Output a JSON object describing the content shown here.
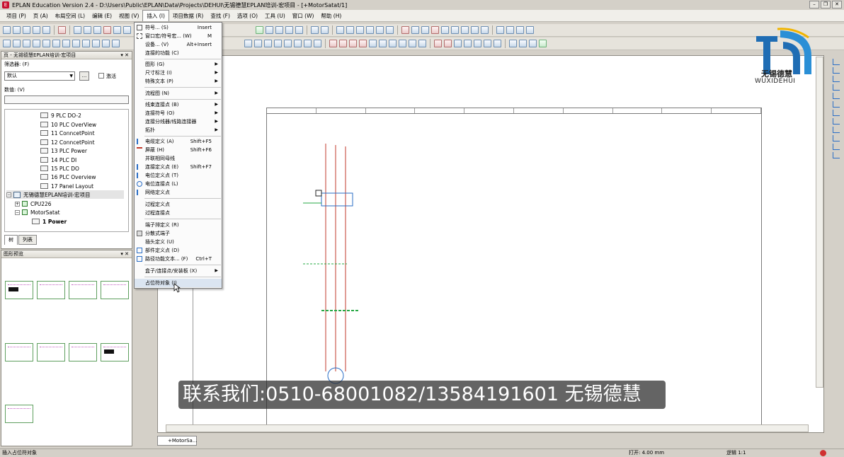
{
  "window": {
    "title": "EPLAN Education Version 2.4 - D:\\Users\\Public\\EPLAN\\Data\\Projects\\DEHUI\\无锡德慧EPLAN培训-宏项目 - [+MotorSatat/1]"
  },
  "menubar": [
    "项目 (P)",
    "页 (A)",
    "布局空间 (L)",
    "编辑 (E)",
    "视图 (V)",
    "插入 (I)",
    "项目数据 (R)",
    "查找 (F)",
    "选项 (O)",
    "工具 (U)",
    "窗口 (W)",
    "帮助 (H)"
  ],
  "page_panel": {
    "title": "页 - 无锡德慧EPLAN培训-宏项目",
    "filter_label": "筛选器: (F)",
    "filter_value": "默认",
    "more_button": "...",
    "activate_label": "激活",
    "value_label": "数值: (V)",
    "pages": [
      "9 PLC DO-2",
      "10 PLC OverView",
      "11 ConncetPoint",
      "12 ConncetPoint",
      "13 PLC Power",
      "14 PLC DI",
      "15 PLC DO",
      "16 PLC Overview",
      "17 Panel Layout"
    ],
    "project": "无锡德慧EPLAN培训-宏项目",
    "node_cpu": "CPU226",
    "node_motor": "MotorSatat",
    "node_power": "1 Power",
    "tab_tree": "树",
    "tab_list": "列表"
  },
  "preview_panel": {
    "title": "图形预览"
  },
  "insert_menu": {
    "items": [
      {
        "label": "符号... (S)",
        "shortcut": "Insert"
      },
      {
        "label": "窗口宏/符号宏... (W)",
        "shortcut": "M"
      },
      {
        "label": "设备... (V)",
        "shortcut": "Alt+Insert"
      },
      {
        "label": "连接的功能 (C)",
        "shortcut": ""
      },
      {
        "label": "图形 (G)",
        "shortcut": ""
      },
      {
        "label": "尺寸标注 (I)",
        "shortcut": ""
      },
      {
        "label": "特殊文本 (P)",
        "shortcut": ""
      },
      {
        "label": "流程图 (N)",
        "shortcut": ""
      },
      {
        "label": "线束连接点 (B)",
        "shortcut": ""
      },
      {
        "label": "连接符号 (O)",
        "shortcut": ""
      },
      {
        "label": "连接分线器/线路连接器",
        "shortcut": ""
      },
      {
        "label": "拓扑",
        "shortcut": ""
      },
      {
        "label": "电缆定义 (A)",
        "shortcut": "Shift+F5"
      },
      {
        "label": "屏蔽 (H)",
        "shortcut": "Shift+F6"
      },
      {
        "label": "并联相同母线",
        "shortcut": ""
      },
      {
        "label": "连接定义点 (E)",
        "shortcut": "Shift+F7"
      },
      {
        "label": "电位定义点 (T)",
        "shortcut": ""
      },
      {
        "label": "电位连接点 (L)",
        "shortcut": ""
      },
      {
        "label": "网络定义点",
        "shortcut": ""
      },
      {
        "label": "过程定义点",
        "shortcut": ""
      },
      {
        "label": "过程连接点",
        "shortcut": ""
      },
      {
        "label": "端子排定义 (R)",
        "shortcut": ""
      },
      {
        "label": "分散式端子",
        "shortcut": ""
      },
      {
        "label": "插头定义 (U)",
        "shortcut": ""
      },
      {
        "label": "部件定义点 (D)",
        "shortcut": ""
      },
      {
        "label": "路径功能文本... (F)",
        "shortcut": "Ctrl+T"
      },
      {
        "label": "盒子/连接点/安装板 (X)",
        "shortcut": ""
      },
      {
        "label": "占位符对象 (J)",
        "shortcut": ""
      }
    ]
  },
  "logo": {
    "cn": "无锡德慧",
    "en": "WUXIDEHUI"
  },
  "caption": "联系我们:0510-68001082/13584191601 无锡德慧",
  "doc_tab": "+MotorSa...",
  "status": {
    "left": "插入占位符对象",
    "grid": "打开: 4.00 mm",
    "scale": "逻辑 1:1"
  },
  "colors": {
    "accent": "#2a6ec6",
    "wire": "#c0392b",
    "green": "#27a844"
  }
}
